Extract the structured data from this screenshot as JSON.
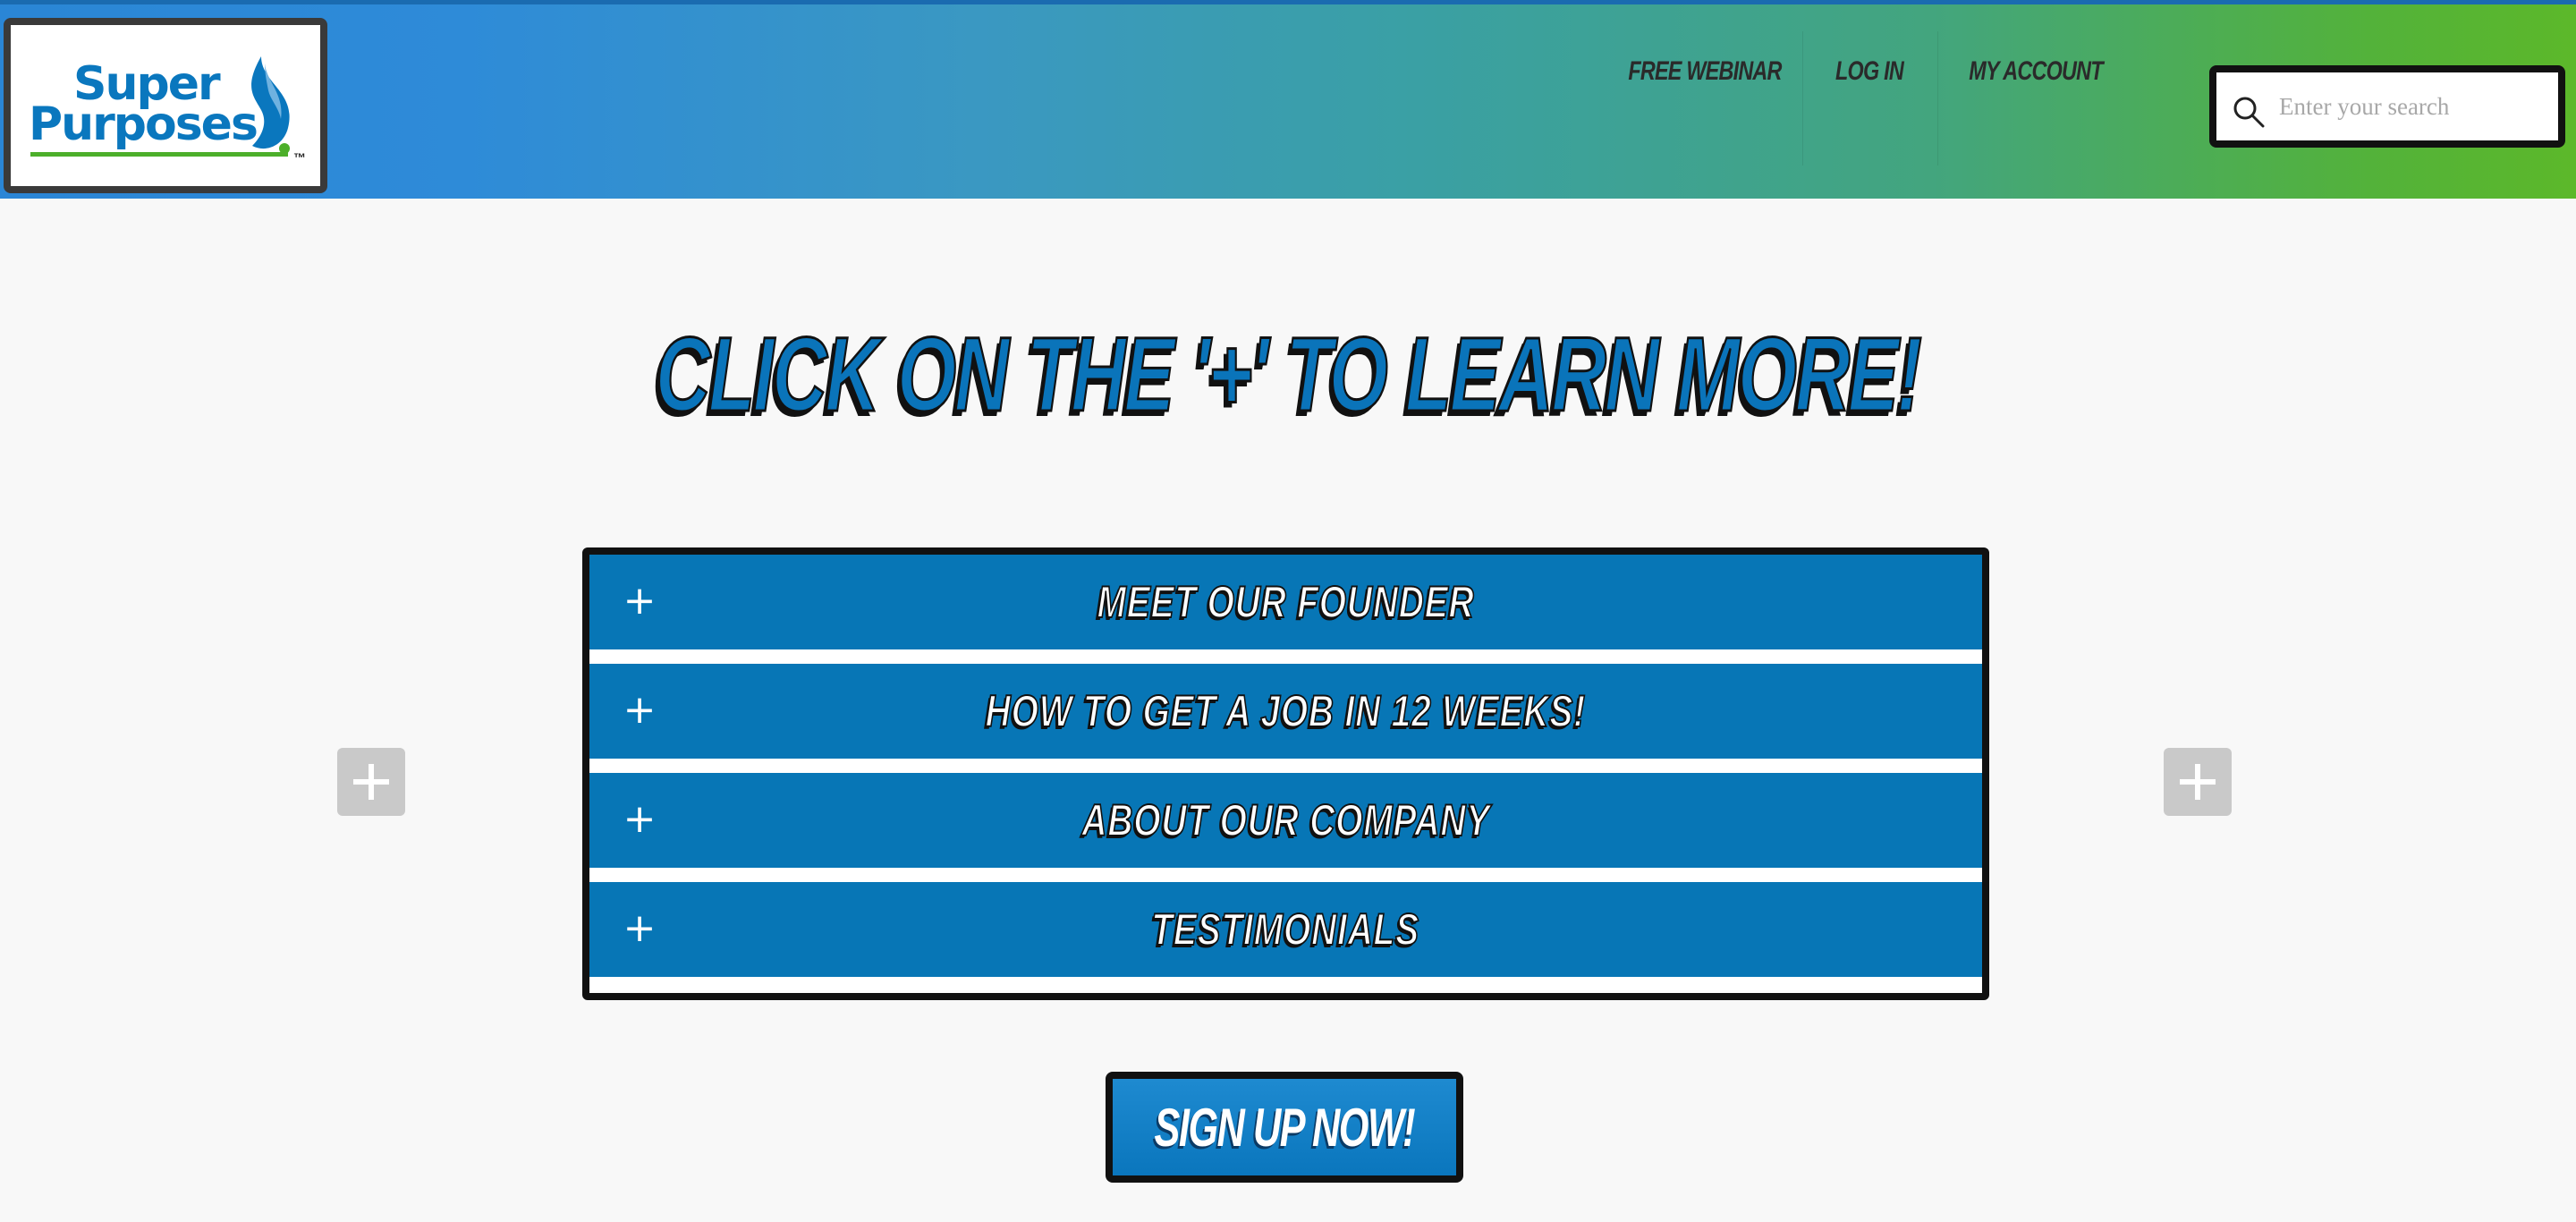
{
  "header": {
    "logo": {
      "line1": "Super",
      "line2": "Purposes",
      "tm": "™"
    },
    "nav": [
      {
        "label": "FREE WEBINAR"
      },
      {
        "label": "LOG IN"
      },
      {
        "label": "MY ACCOUNT"
      }
    ],
    "search": {
      "placeholder": "Enter your search",
      "value": ""
    }
  },
  "main": {
    "heading": "CLICK ON THE '+' TO LEARN MORE!",
    "accordion": [
      {
        "icon": "+",
        "label": "MEET OUR FOUNDER"
      },
      {
        "icon": "+",
        "label": "HOW TO GET A JOB IN 12 WEEKS!"
      },
      {
        "icon": "+",
        "label": "ABOUT OUR COMPANY"
      },
      {
        "icon": "+",
        "label": "TESTIMONIALS"
      }
    ],
    "signup_label": "SIGN UP NOW!"
  },
  "colors": {
    "brand_blue": "#0776b6",
    "brand_green": "#5cb82a",
    "dark": "#111111",
    "side_button": "#c9c9c9"
  },
  "icons": {
    "search": "search-icon",
    "plus": "plus-icon",
    "logo_mark": "drop-logo-icon"
  }
}
